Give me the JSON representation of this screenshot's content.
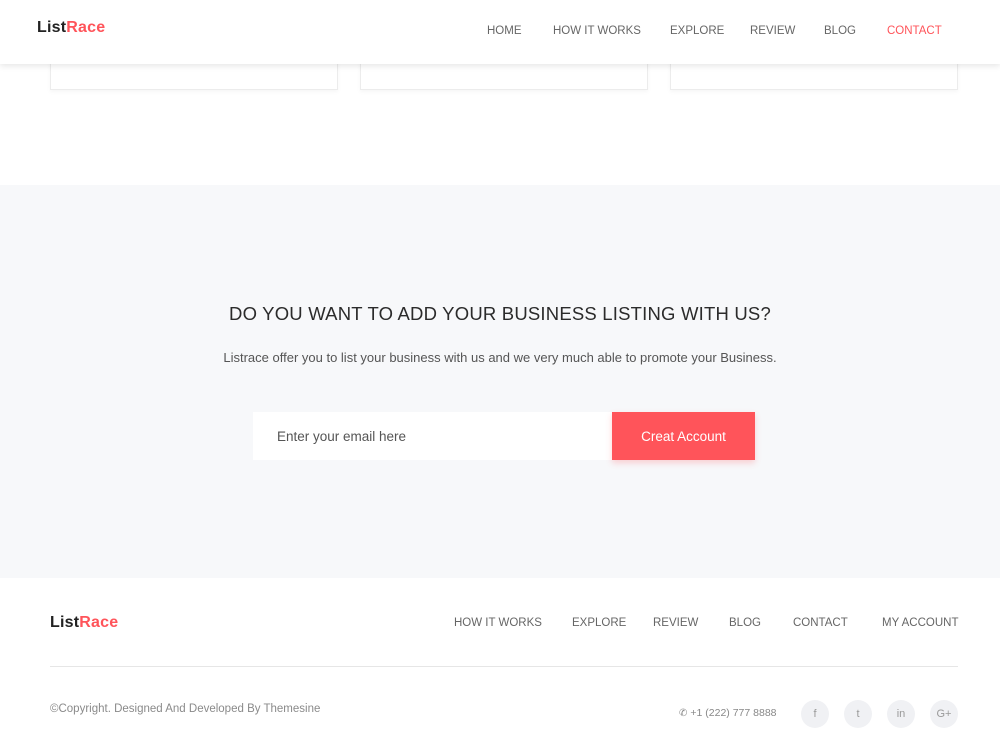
{
  "header": {
    "logo_part1": "List",
    "logo_part2": "Race",
    "nav": [
      "HOME",
      "HOW IT WORKS",
      "EXPLORE",
      "REVIEW",
      "BLOG",
      "CONTACT"
    ],
    "active_color": "#ff545a"
  },
  "subscribe": {
    "title": "DO YOU WANT TO ADD YOUR BUSINESS LISTING WITH US?",
    "text": "Listrace offer you to list your business with us and we very much able to promote your Business.",
    "email_placeholder": "Enter your email here",
    "button_label": "Creat Account"
  },
  "footer": {
    "logo_part1": "List",
    "logo_part2": "Race",
    "nav": [
      "HOW IT WORKS",
      "EXPLORE",
      "REVIEW",
      "BLOG",
      "CONTACT",
      "MY ACCOUNT"
    ],
    "copyright": "©Copyright. Designed And Developed By Themesine",
    "phone": "+1 (222) 777 8888",
    "social": [
      "f",
      "t",
      "in",
      "G+"
    ],
    "social_icons": [
      "facebook-icon",
      "twitter-icon",
      "linkedin-icon",
      "google-plus-icon"
    ]
  },
  "colors": {
    "accent": "#ff545a",
    "section_bg": "#f7f8fa"
  }
}
